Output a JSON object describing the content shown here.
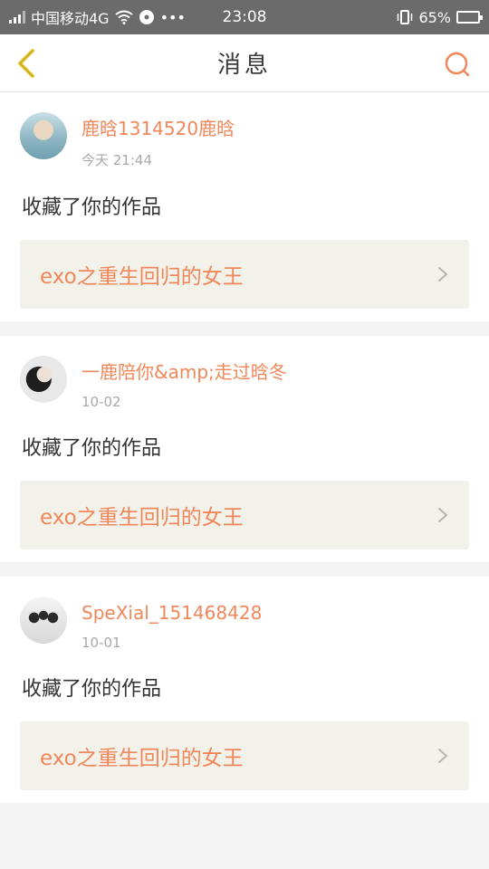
{
  "status_bar": {
    "carrier": "中国移动4G",
    "dots": "•••",
    "time": "23:08",
    "battery_percent": "65%",
    "battery_level": 0.65
  },
  "header": {
    "title": "消息",
    "back_icon": "chevron-left-icon",
    "search_icon": "search-icon"
  },
  "colors": {
    "accent": "#f0875a",
    "back_arrow": "#e9c52b"
  },
  "notifications": [
    {
      "username": "鹿晗1314520鹿晗",
      "time": "今天 21:44",
      "action": "收藏了你的作品",
      "work_title": "exo之重生回归的女王",
      "avatar": "avatar-icon"
    },
    {
      "username": "一鹿陪你&amp;走过晗冬",
      "time": "10-02",
      "action": "收藏了你的作品",
      "work_title": "exo之重生回归的女王",
      "avatar": "avatar-icon"
    },
    {
      "username": "SpeXial_151468428",
      "time": "10-01",
      "action": "收藏了你的作品",
      "work_title": "exo之重生回归的女王",
      "avatar": "avatar-icon"
    }
  ]
}
